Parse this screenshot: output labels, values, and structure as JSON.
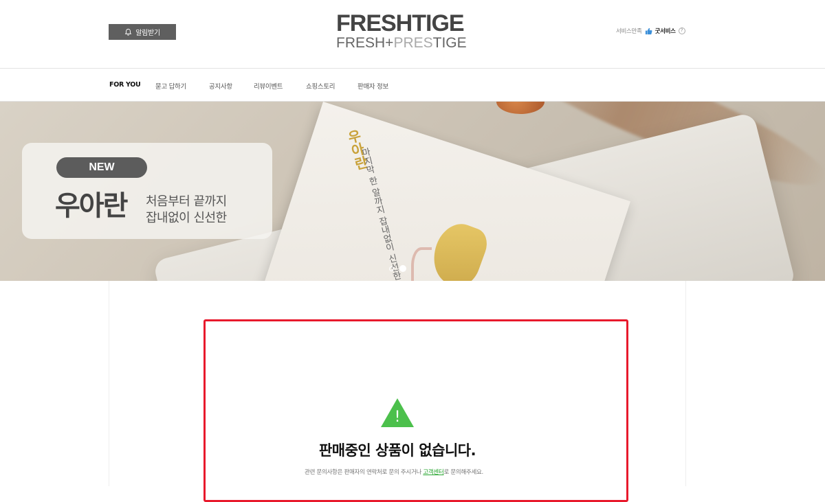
{
  "header": {
    "alarm_label": "알림받기",
    "logo_main": "FRESHTIGE",
    "logo_sub_a": "FRESH+",
    "logo_sub_b": "PRES",
    "logo_sub_c": "TIGE",
    "service_label": "서비스만족",
    "service_grade": "굿서비스",
    "help_glyph": "?"
  },
  "nav": {
    "items": [
      {
        "label": "FOR YOU"
      },
      {
        "label": "묻고 답하기"
      },
      {
        "label": "공지사항"
      },
      {
        "label": "리뷰이벤트"
      },
      {
        "label": "쇼핑스토리"
      },
      {
        "label": "판매자 정보"
      }
    ]
  },
  "banner": {
    "badge": "NEW",
    "title": "우아란",
    "desc_line1": "처음부터 끝까지",
    "desc_line2": "잡내없이 신선한",
    "card_brand": "우아란",
    "card_text": "마지막 한 알까지 잡내없이 신선한"
  },
  "empty_state": {
    "title": "판매중인 상품이 없습니다.",
    "desc_prefix": "관련 문의사항은 판매자의 연락처로 문의 주시거나 ",
    "desc_link": "고객센터",
    "desc_suffix": "로 문의해주세요.",
    "icon_glyph": "!"
  },
  "colors": {
    "accent_red": "#e8192c",
    "warning_green": "#4cc04c",
    "link_green": "#23a32b",
    "badge_gray": "#5c5c5c"
  }
}
